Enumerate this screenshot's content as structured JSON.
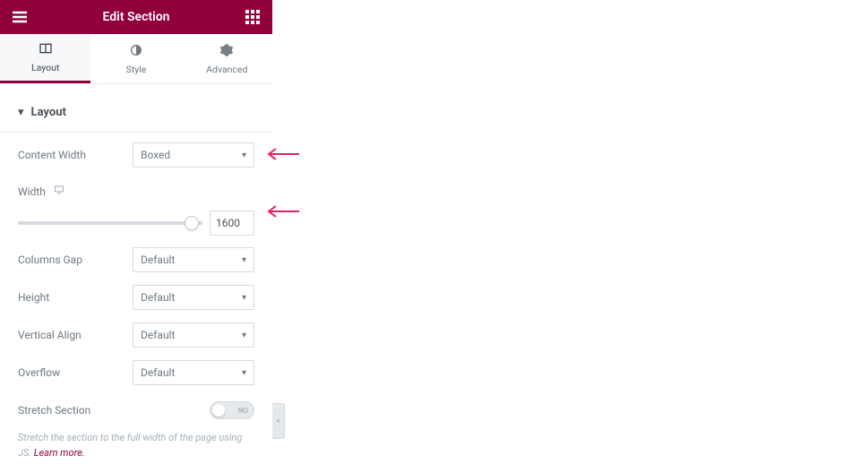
{
  "header": {
    "title": "Edit Section"
  },
  "tabs": {
    "layout": "Layout",
    "style": "Style",
    "advanced": "Advanced"
  },
  "section": {
    "title": "Layout"
  },
  "fields": {
    "content_width": {
      "label": "Content Width",
      "value": "Boxed"
    },
    "width": {
      "label": "Width",
      "value": "1600"
    },
    "columns_gap": {
      "label": "Columns Gap",
      "value": "Default"
    },
    "height": {
      "label": "Height",
      "value": "Default"
    },
    "vertical_align": {
      "label": "Vertical Align",
      "value": "Default"
    },
    "overflow": {
      "label": "Overflow",
      "value": "Default"
    },
    "stretch": {
      "label": "Stretch Section",
      "state": "NO",
      "helper_text": "Stretch the section to the full width of the page using JS.",
      "learn_more": "Learn more."
    }
  }
}
